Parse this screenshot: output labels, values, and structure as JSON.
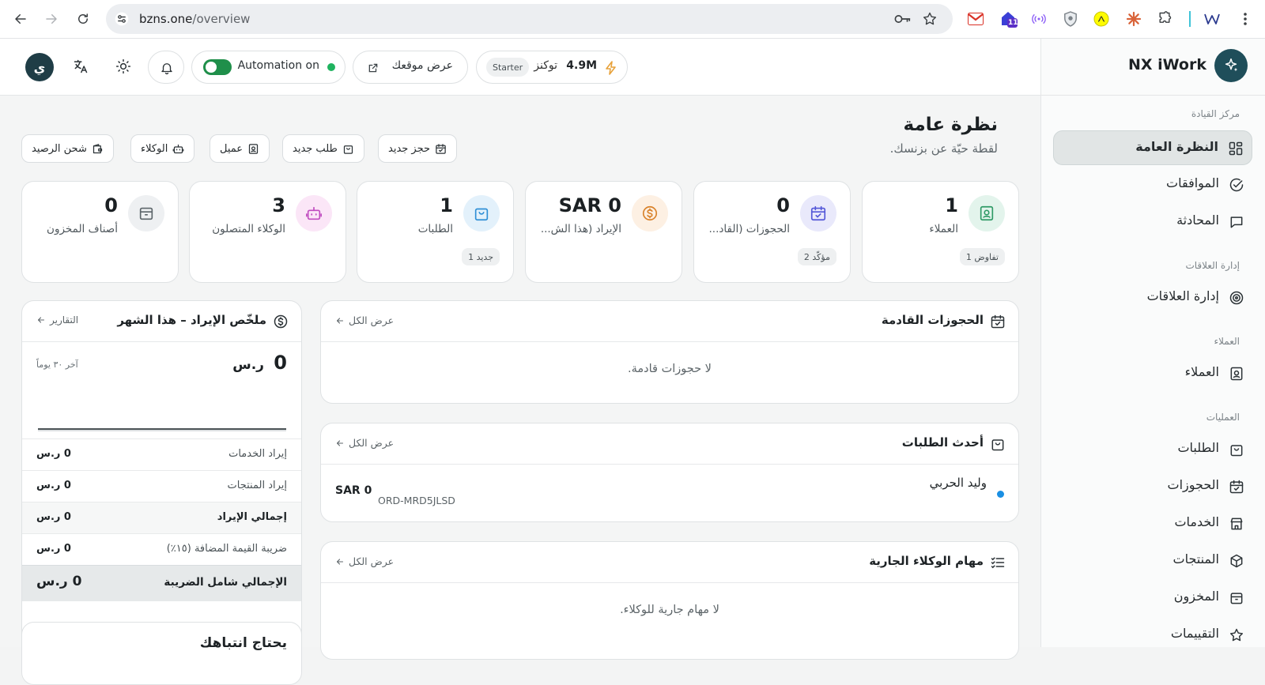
{
  "browser": {
    "url_host": "bzns.one",
    "url_path": "/overview",
    "ext_badge": "11"
  },
  "brand": {
    "name": "NX iWork"
  },
  "sidebar": {
    "sections": [
      {
        "label": "مركز القيادة"
      },
      {
        "label": "إدارة العلاقات"
      },
      {
        "label": "العملاء"
      },
      {
        "label": "العمليات"
      }
    ],
    "items": [
      {
        "label": "النظرة العامة",
        "active": true
      },
      {
        "label": "الموافقات"
      },
      {
        "label": "المحادثة"
      },
      {
        "label": "إدارة العلاقات"
      },
      {
        "label": "العملاء"
      },
      {
        "label": "الطلبات"
      },
      {
        "label": "الحجوزات"
      },
      {
        "label": "الخدمات"
      },
      {
        "label": "المنتجات"
      },
      {
        "label": "المخزون"
      },
      {
        "label": "التقييمات"
      }
    ]
  },
  "topbar": {
    "tokens_value": "4.9M",
    "tokens_label": "توكنز",
    "plan": "Starter",
    "view_site": "عرض موقعك",
    "automation": "Automation on",
    "avatar": "ي"
  },
  "page": {
    "title": "نظرة عامة",
    "subtitle": "لقطة حيّة عن بزنسك."
  },
  "quick_actions": [
    {
      "label": "حجز جديد"
    },
    {
      "label": "طلب جديد"
    },
    {
      "label": "عميل"
    },
    {
      "label": "الوكلاء"
    },
    {
      "label": "شحن الرصيد"
    }
  ],
  "stats": [
    {
      "value": "1",
      "label": "العملاء",
      "badge": "تفاوض 1"
    },
    {
      "value": "0",
      "label": "الحجوزات (القاد...",
      "badge": "مؤكّد 2"
    },
    {
      "value": "SAR 0",
      "label": "الإيراد (هذا الش..."
    },
    {
      "value": "1",
      "label": "الطلبات",
      "badge": "جديد 1"
    },
    {
      "value": "3",
      "label": "الوكلاء المتصلون"
    },
    {
      "value": "0",
      "label": "أصناف المخزون"
    }
  ],
  "cards": {
    "view_all": "عرض الكل",
    "bookings": {
      "title": "الحجوزات القادمة",
      "empty": "لا حجوزات قادمة."
    },
    "orders": {
      "title": "أحدث الطلبات",
      "rows": [
        {
          "customer": "وليد الحربي",
          "order_id": "ORD-MRD5JLSD",
          "amount": "SAR 0",
          "status_color": "#1a8fe3"
        }
      ]
    },
    "agent_tasks": {
      "title": "مهام الوكلاء الجارية",
      "empty": "لا مهام جارية للوكلاء."
    },
    "attention": {
      "title": "يحتاج انتباهك"
    }
  },
  "revenue": {
    "title": "ملخّص الإيراد – هذا الشهر",
    "reports": "التقارير",
    "total_big": "0",
    "currency": "ر.س",
    "period": "آخر ٣٠ يوماً",
    "rows": [
      {
        "label": "إيراد الخدمات",
        "value": "0 ر.س"
      },
      {
        "label": "إيراد المنتجات",
        "value": "0 ر.س"
      },
      {
        "label": "إجمالي الإيراد",
        "value": "0 ر.س"
      },
      {
        "label": "ضريبة القيمة المضافة (١٥٪)",
        "value": "0 ر.س"
      }
    ],
    "grand_label": "الإجمالي شامل الضريبة",
    "grand_value": "0 ر.س"
  },
  "colors": {
    "accent": "#1f4e5a",
    "toggle_on": "#1f8f4a",
    "status_dot": "#1a8fe3"
  }
}
